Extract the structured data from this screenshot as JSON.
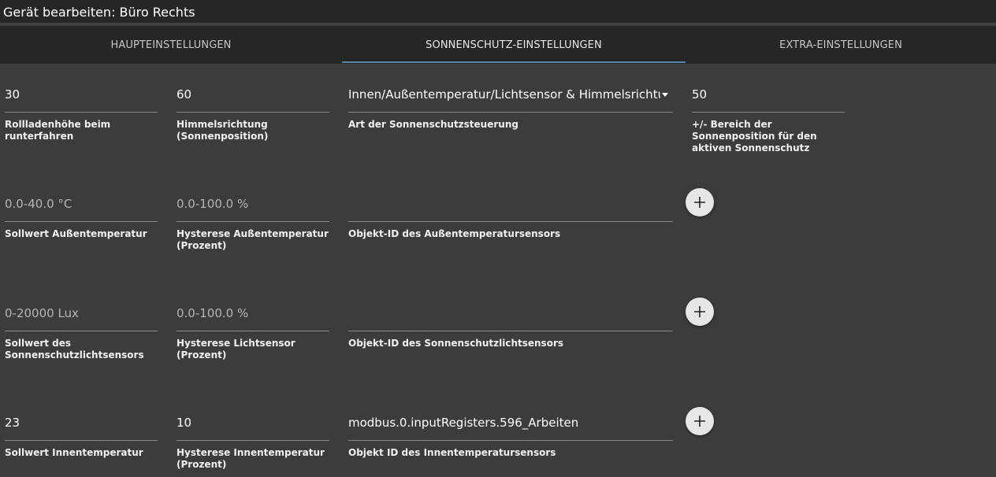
{
  "window": {
    "title": "Gerät bearbeiten: Büro Rechts"
  },
  "tabs": [
    {
      "label": "HAUPTEINSTELLUNGEN"
    },
    {
      "label": "SONNENSCHUTZ-EINSTELLUNGEN"
    },
    {
      "label": "EXTRA-EINSTELLUNGEN"
    }
  ],
  "rows": [
    {
      "fields": [
        {
          "value": "30",
          "label": "Rollladenhöhe beim runterfahren"
        },
        {
          "value": "60",
          "label": "Himmelsrichtung (Sonnenposition)"
        },
        {
          "value": "Innen/Außentemperatur/Lichtsensor & Himmelsrichtung",
          "label": "Art der Sonnenschutzsteuerung"
        },
        {
          "value": "50",
          "label": "+/- Bereich der Sonnenposition für den aktiven Sonnenschutz"
        }
      ]
    },
    {
      "fields": [
        {
          "placeholder": "0.0-40.0 °C",
          "label": "Sollwert Außentemperatur"
        },
        {
          "placeholder": "0.0-100.0 %",
          "label": "Hysterese Außentemperatur (Prozent)"
        },
        {
          "value": "",
          "label": "Objekt-ID des Außentemperatursensors"
        }
      ]
    },
    {
      "fields": [
        {
          "placeholder": "0-20000 Lux",
          "label": "Sollwert des Sonnenschutzlichtsensors"
        },
        {
          "placeholder": "0.0-100.0 %",
          "label": "Hysterese Lichtsensor (Prozent)"
        },
        {
          "value": "",
          "label": "Objekt-ID des Sonnenschutzlichtsensors"
        }
      ]
    },
    {
      "fields": [
        {
          "value": "23",
          "label": "Sollwert Innentemperatur"
        },
        {
          "value": "10",
          "label": "Hysterese Innentemperatur (Prozent)"
        },
        {
          "value": "modbus.0.inputRegisters.596_Arbeiten",
          "label": "Objekt ID des Innentemperatursensors"
        }
      ]
    }
  ],
  "icons": {
    "add": "plus-icon",
    "dropdown": "caret-down-icon"
  },
  "colors": {
    "accent": "#5b86a8",
    "background": "#3c3c3c",
    "header": "#262626"
  }
}
